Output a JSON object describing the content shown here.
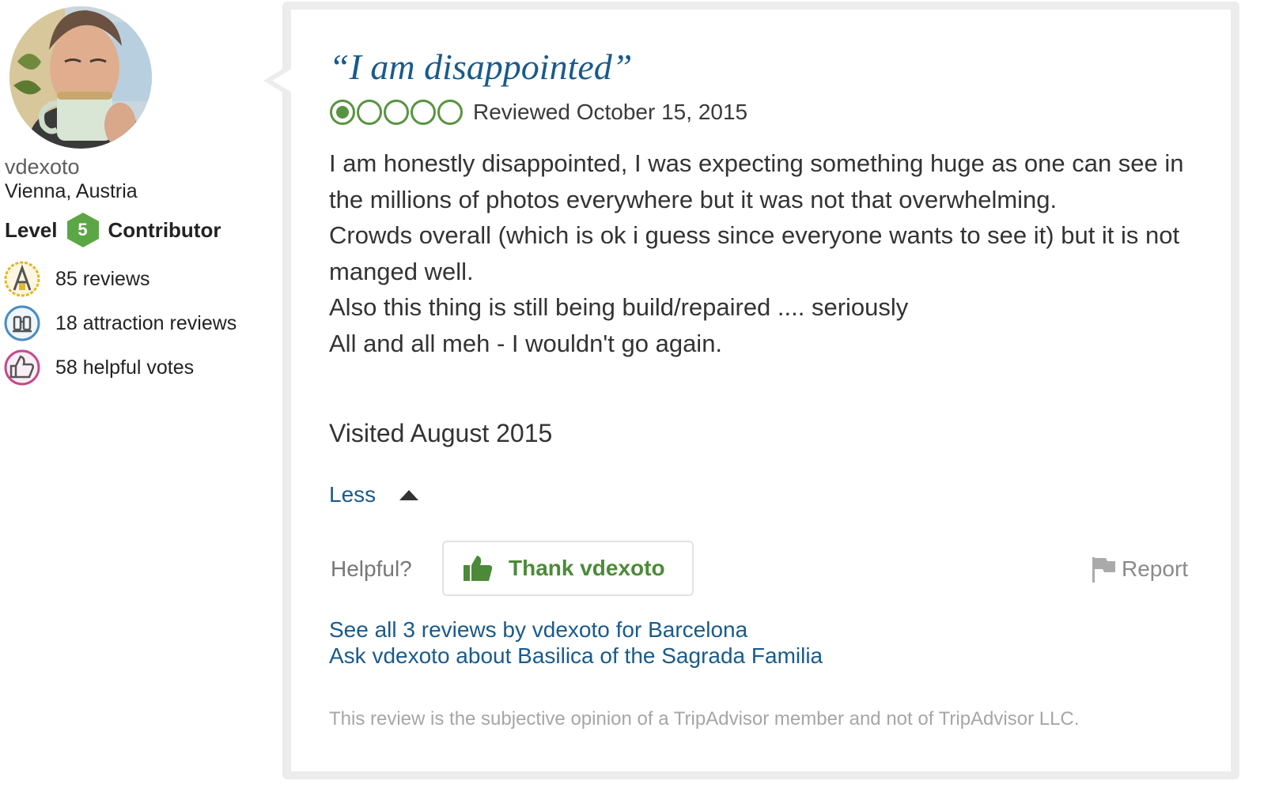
{
  "member": {
    "username": "vdexoto",
    "location": "Vienna, Austria",
    "level_label": "Level",
    "level_number": "5",
    "level_suffix": "Contributor",
    "badges": [
      {
        "icon": "reviews-badge-icon",
        "text": "85 reviews"
      },
      {
        "icon": "attraction-reviews-badge-icon",
        "text": "18 attraction reviews"
      },
      {
        "icon": "helpful-votes-badge-icon",
        "text": "58 helpful votes"
      }
    ]
  },
  "review": {
    "title": "“I am disappointed”",
    "rating": 1,
    "rating_max": 5,
    "date": "Reviewed October 15, 2015",
    "body": [
      "I am honestly disappointed, I was expecting something huge as one can see in the millions of photos everywhere but it was not that overwhelming.",
      "Crowds overall (which is ok i guess since everyone wants to see it) but it is not manged well.",
      "Also this thing is still being build/repaired .... seriously",
      "All and all meh - I wouldn't go again."
    ],
    "visited": "Visited August 2015",
    "less_label": "Less",
    "helpful_label": "Helpful?",
    "thank_button": "Thank vdexoto",
    "report_label": "Report",
    "links": [
      "See all 3 reviews by vdexoto for Barcelona",
      "Ask vdexoto about Basilica of the Sagrada Familia"
    ],
    "disclaimer": "This review is the subjective opinion of a TripAdvisor member and not of TripAdvisor LLC."
  },
  "colors": {
    "link": "#1a5a8c",
    "rating_green": "#589442",
    "level_green": "#5ba745",
    "thank_green": "#4c8a3a"
  }
}
